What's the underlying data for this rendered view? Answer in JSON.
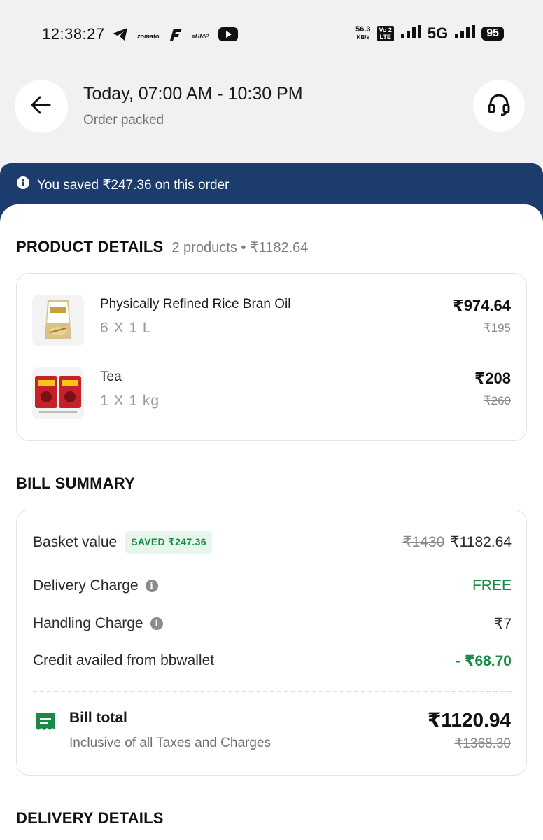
{
  "status_bar": {
    "time": "12:38:27",
    "apps": [
      "telegram-icon",
      "zomato",
      "flipkart-icon",
      "hmp",
      "youtube-icon"
    ],
    "app_labels": {
      "zomato": "zomato",
      "hmp": "≡HMP"
    },
    "speed": "56.3",
    "speed_unit": "KB/s",
    "volte_top": "Vo 2",
    "volte_bottom": "LTE",
    "network": "5G",
    "battery": "95"
  },
  "header": {
    "title": "Today, 07:00 AM - 10:30 PM",
    "subtitle": "Order packed"
  },
  "banner": {
    "text": "You saved ₹247.36 on this order"
  },
  "product_details": {
    "title": "PRODUCT DETAILS",
    "summary": "2 products • ₹1182.64",
    "items": [
      {
        "name": "Physically Refined Rice Bran Oil",
        "qty": "6 X 1 L",
        "price": "₹974.64",
        "mrp": "₹195"
      },
      {
        "name": "Tea",
        "qty": "1 X 1 kg",
        "price": "₹208",
        "mrp": "₹260"
      }
    ]
  },
  "bill_summary": {
    "title": "BILL SUMMARY",
    "basket_label": "Basket value",
    "saved_badge": "SAVED ₹247.36",
    "basket_mrp": "₹1430",
    "basket_value": "₹1182.64",
    "delivery_label": "Delivery Charge",
    "delivery_value": "FREE",
    "handling_label": "Handling Charge",
    "handling_value": "₹7",
    "credit_label": "Credit availed from bbwallet",
    "credit_value": "- ₹68.70",
    "total_label": "Bill total",
    "total_note": "Inclusive of all Taxes and Charges",
    "total_value": "₹1120.94",
    "total_mrp": "₹1368.30"
  },
  "delivery_details": {
    "title": "DELIVERY DETAILS"
  },
  "colors": {
    "banner": "#1d3c6e",
    "saved_green": "#178a45",
    "background": "#f1f1f1"
  }
}
